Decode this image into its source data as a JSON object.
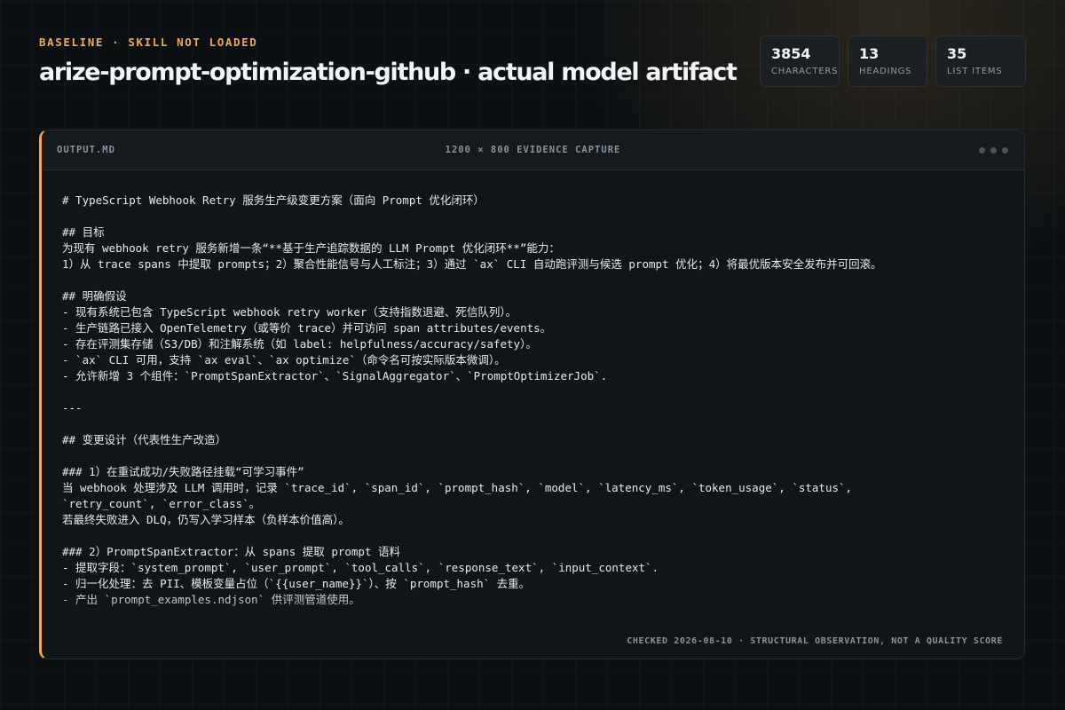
{
  "header": {
    "eyebrow": "BASELINE · SKILL NOT LOADED",
    "title": "arize-prompt-optimization-github · actual model artifact"
  },
  "stats": [
    {
      "value": "3854",
      "label": "CHARACTERS"
    },
    {
      "value": "13",
      "label": "HEADINGS"
    },
    {
      "value": "35",
      "label": "LIST ITEMS"
    }
  ],
  "panel": {
    "filename": "OUTPUT.MD",
    "caption": "1200 × 800 EVIDENCE CAPTURE",
    "footer": "CHECKED 2026-08-10 · STRUCTURAL OBSERVATION, NOT A QUALITY SCORE",
    "lines": [
      "# TypeScript Webhook Retry 服务生产级变更方案（面向 Prompt 优化闭环）",
      "",
      "## 目标",
      "为现有 webhook retry 服务新增一条“**基于生产追踪数据的 LLM Prompt 优化闭环**”能力：",
      "1）从 trace spans 中提取 prompts；2）聚合性能信号与人工标注；3）通过 `ax` CLI 自动跑评测与候选 prompt 优化；4）将最优版本安全发布并可回滚。",
      "",
      "## 明确假设",
      "- 现有系统已包含 TypeScript webhook retry worker（支持指数退避、死信队列）。",
      "- 生产链路已接入 OpenTelemetry（或等价 trace）并可访问 span attributes/events。",
      "- 存在评测集存储（S3/DB）和注解系统（如 label: helpfulness/accuracy/safety）。",
      "- `ax` CLI 可用，支持 `ax eval`、`ax optimize`（命令名可按实际版本微调）。",
      "- 允许新增 3 个组件：`PromptSpanExtractor`、`SignalAggregator`、`PromptOptimizerJob`.",
      "",
      "---",
      "",
      "## 变更设计（代表性生产改造）",
      "",
      "### 1）在重试成功/失败路径挂载“可学习事件”",
      "当 webhook 处理涉及 LLM 调用时，记录 `trace_id`, `span_id`, `prompt_hash`, `model`, `latency_ms`, `token_usage`, `status`,",
      "`retry_count`, `error_class`。",
      "若最终失败进入 DLQ，仍写入学习样本（负样本价值高）。",
      "",
      "### 2）PromptSpanExtractor：从 spans 提取 prompt 语料",
      "- 提取字段：`system_prompt`, `user_prompt`, `tool_calls`, `response_text`, `input_context`.",
      "- 归一化处理：去 PII、模板变量占位（`{{user_name}}`）、按 `prompt_hash` 去重。",
      "- 产出 `prompt_examples.ndjson` 供评测管道使用。"
    ]
  }
}
